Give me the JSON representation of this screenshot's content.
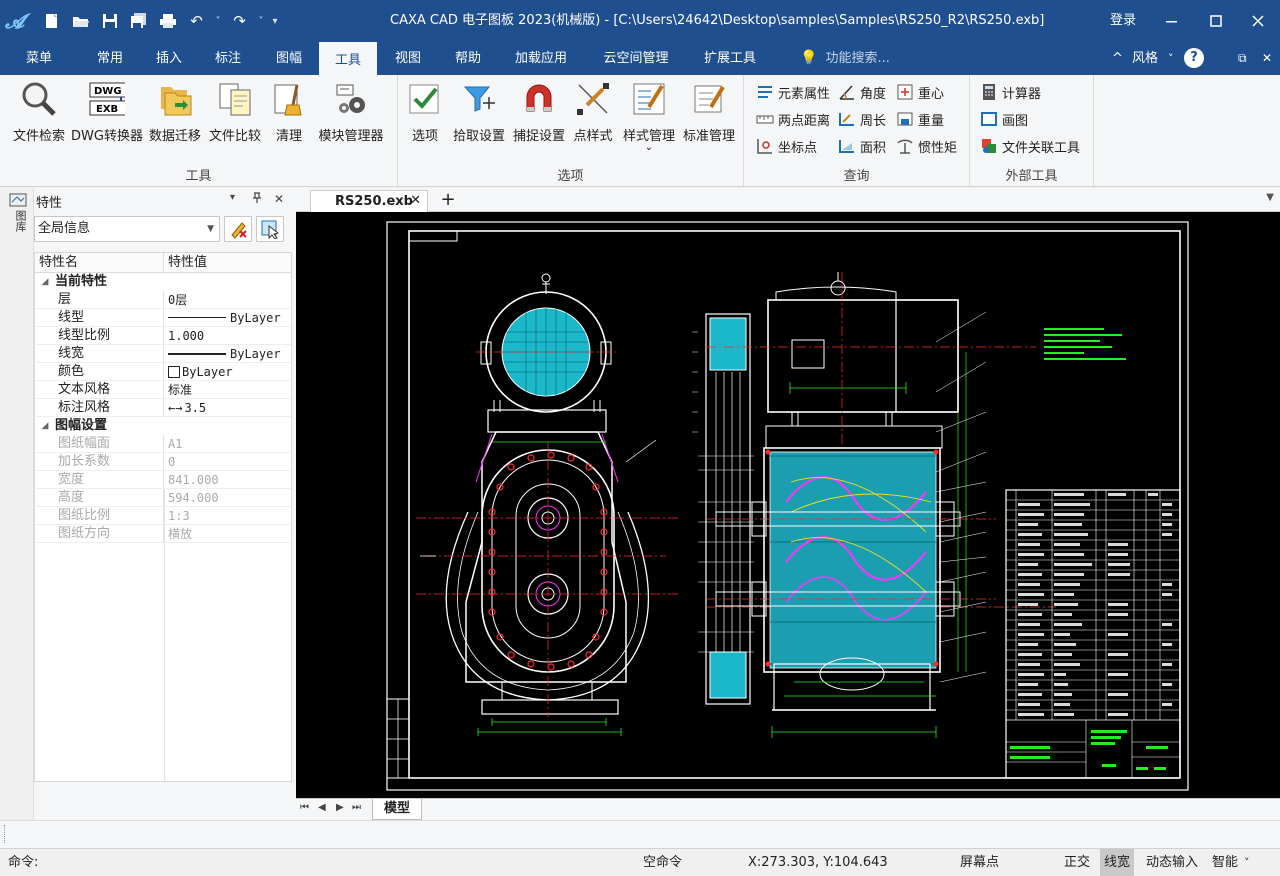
{
  "titlebar": {
    "title": "CAXA CAD 电子图板 2023(机械版) - [C:\\Users\\24642\\Desktop\\samples\\Samples\\RS250_R2\\RS250.exb]",
    "login": "登录",
    "minimize": "—",
    "maximize": "☐",
    "close": "✕"
  },
  "qat": {
    "new": "▆",
    "open": "🗁",
    "save": "💾",
    "saveall": "⎘",
    "print": "⎙",
    "undo": "↶",
    "undo_drop": "˅",
    "redo": "↷",
    "redo_drop": "˅",
    "customize": "≡"
  },
  "menu": {
    "tabs": [
      "菜单",
      "常用",
      "插入",
      "标注",
      "图幅",
      "工具",
      "视图",
      "帮助",
      "加载应用",
      "云空间管理",
      "扩展工具"
    ],
    "active_index": 5,
    "search_placeholder": "功能搜索...",
    "style_label": "风格",
    "collapse": "^",
    "style_caret": "˅",
    "help": "?",
    "restore": "⧉",
    "close": "✕"
  },
  "ribbon": {
    "tools_group": {
      "label": "工具",
      "buttons": [
        "文件检索",
        "DWG转换器",
        "数据迁移",
        "文件比较",
        "清理",
        "模块管理器"
      ]
    },
    "options_group": {
      "label": "选项",
      "buttons": [
        "选项",
        "拾取设置",
        "捕捉设置",
        "点样式",
        "样式管理",
        "标准管理"
      ],
      "dropdown_caret": "⌄"
    },
    "query_group": {
      "label": "查询",
      "items": [
        "元素属性",
        "角度",
        "重心",
        "两点距离",
        "周长",
        "重量",
        "坐标点",
        "面积",
        "惯性矩"
      ]
    },
    "external_group": {
      "label": "外部工具",
      "items": [
        "计算器",
        "画图",
        "文件关联工具"
      ]
    }
  },
  "properties": {
    "side_tab": "图库",
    "title": "特性",
    "pin": "ᵖ",
    "dropdown": "▾",
    "close": "✕",
    "combo_value": "全局信息",
    "col_name": "特性名",
    "col_value": "特性值",
    "current_category": "当前特性",
    "current_rows": [
      {
        "name": "层",
        "value": "0层"
      },
      {
        "name": "线型",
        "value": "ByLayer"
      },
      {
        "name": "线型比例",
        "value": "1.000"
      },
      {
        "name": "线宽",
        "value": "ByLayer"
      },
      {
        "name": "颜色",
        "value": "ByLayer"
      },
      {
        "name": "文本风格",
        "value": "标准"
      },
      {
        "name": "标注风格",
        "value": "3.5"
      }
    ],
    "sheet_category": "图幅设置",
    "sheet_rows": [
      {
        "name": "图纸幅面",
        "value": "A1"
      },
      {
        "name": "加长系数",
        "value": "0"
      },
      {
        "name": "宽度",
        "value": "841.000"
      },
      {
        "name": "高度",
        "value": "594.000"
      },
      {
        "name": "图纸比例",
        "value": "1:3"
      },
      {
        "name": "图纸方向",
        "value": "横放"
      }
    ]
  },
  "document": {
    "tab_label": "RS250.exb",
    "tab_close": "✕",
    "add_tab": "+",
    "tab_menu": "▼",
    "model_tab": "模型",
    "nav": [
      "⏮",
      "◀",
      "▶",
      "⏭"
    ]
  },
  "status": {
    "command_label": "命令:",
    "empty_command": "空命令",
    "coords": "X:273.303, Y:104.643",
    "screen_point": "屏幕点",
    "ortho": "正交",
    "linewidth": "线宽",
    "dynamic_input": "动态输入",
    "smart": "智能",
    "smart_caret": "˅"
  },
  "colors": {
    "titlebar": "#1f4f8f",
    "canvas": "#000000",
    "cad_white": "#ffffff",
    "cad_red": "#ff2a2a",
    "cad_cyan": "#22e6e6",
    "cad_magenta": "#ff33ff",
    "cad_yellow": "#f0e020",
    "cad_green": "#22ee22"
  }
}
